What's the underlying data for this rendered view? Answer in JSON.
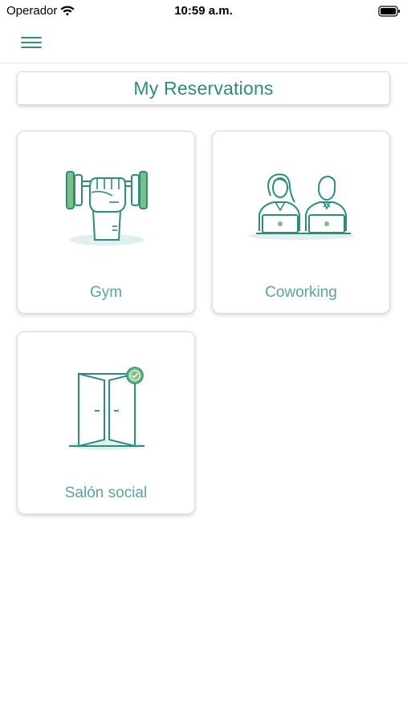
{
  "status_bar": {
    "carrier": "Operador",
    "time": "10:59 a.m."
  },
  "nav": {
    "menu_icon": "hamburger-menu-icon"
  },
  "page": {
    "title": "My Reservations"
  },
  "cards": [
    {
      "label": "Gym",
      "icon": "dumbbell-icon"
    },
    {
      "label": "Coworking",
      "icon": "coworking-people-icon"
    },
    {
      "label": "Salón social",
      "icon": "open-door-icon"
    }
  ],
  "colors": {
    "accent": "#2b8c80",
    "icon_fill": "#7cbf85",
    "shadow_ellipse": "#dff0ee"
  }
}
